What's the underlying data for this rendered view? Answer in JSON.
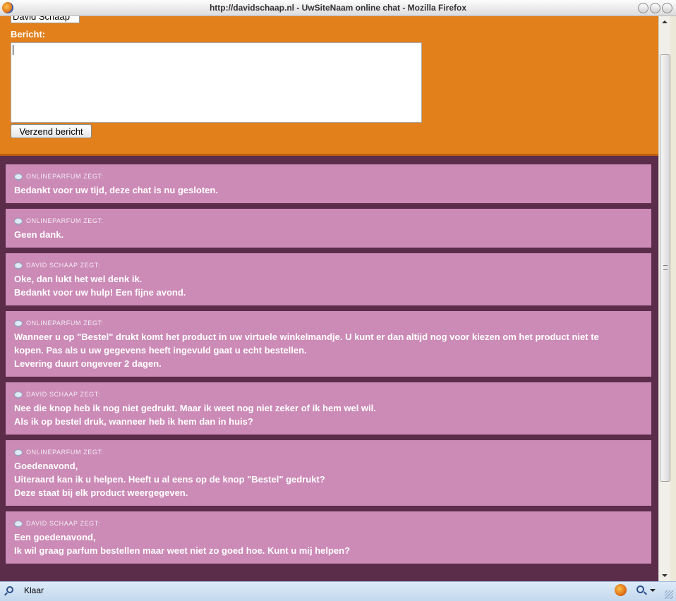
{
  "window": {
    "title": "http://davidschaap.nl - UwSiteNaam online chat - Mozilla Firefox"
  },
  "form": {
    "name_value": "David Schaap",
    "message_label": "Bericht:",
    "message_value": "",
    "send_label": "Verzend bericht"
  },
  "messages": [
    {
      "author": "ONLINEPARFUM ZEGT:",
      "lines": [
        "Bedankt voor uw tijd, deze chat is nu gesloten."
      ]
    },
    {
      "author": "ONLINEPARFUM ZEGT:",
      "lines": [
        "Geen dank."
      ]
    },
    {
      "author": "DAVID SCHAAP ZEGT:",
      "lines": [
        "Oke, dan lukt het wel denk ik.",
        "Bedankt voor uw hulp! Een fijne avond."
      ]
    },
    {
      "author": "ONLINEPARFUM ZEGT:",
      "lines": [
        "Wanneer u op \"Bestel\" drukt komt het product in uw virtuele winkelmandje. U kunt er dan altijd nog voor kiezen om het product niet te",
        "kopen. Pas als u uw gegevens heeft ingevuld gaat u echt bestellen.",
        "Levering duurt ongeveer 2 dagen."
      ]
    },
    {
      "author": "DAVID SCHAAP ZEGT:",
      "lines": [
        "Nee die knop heb ik nog niet gedrukt. Maar ik weet nog niet zeker of ik hem wel wil.",
        "Als ik op bestel druk, wanneer heb ik hem dan in huis?"
      ]
    },
    {
      "author": "ONLINEPARFUM ZEGT:",
      "lines": [
        "Goedenavond,",
        "Uiteraard kan ik u helpen. Heeft u al eens op de knop \"Bestel\" gedrukt?",
        "Deze staat bij elk product weergegeven."
      ]
    },
    {
      "author": "DAVID SCHAAP ZEGT:",
      "lines": [
        "Een goedenavond,",
        "Ik wil graag parfum bestellen maar weet niet zo goed hoe. Kunt u mij helpen?"
      ]
    }
  ],
  "status": {
    "text": "Klaar"
  },
  "icons": {
    "app": "firefox-icon",
    "bubble": "chat-bubble-icon",
    "status_search": "search-icon",
    "zoom": "zoom-icon"
  },
  "colors": {
    "form_background": "#e2801b",
    "message_background": "#cc8ab6",
    "page_background": "#5b2d4b"
  }
}
